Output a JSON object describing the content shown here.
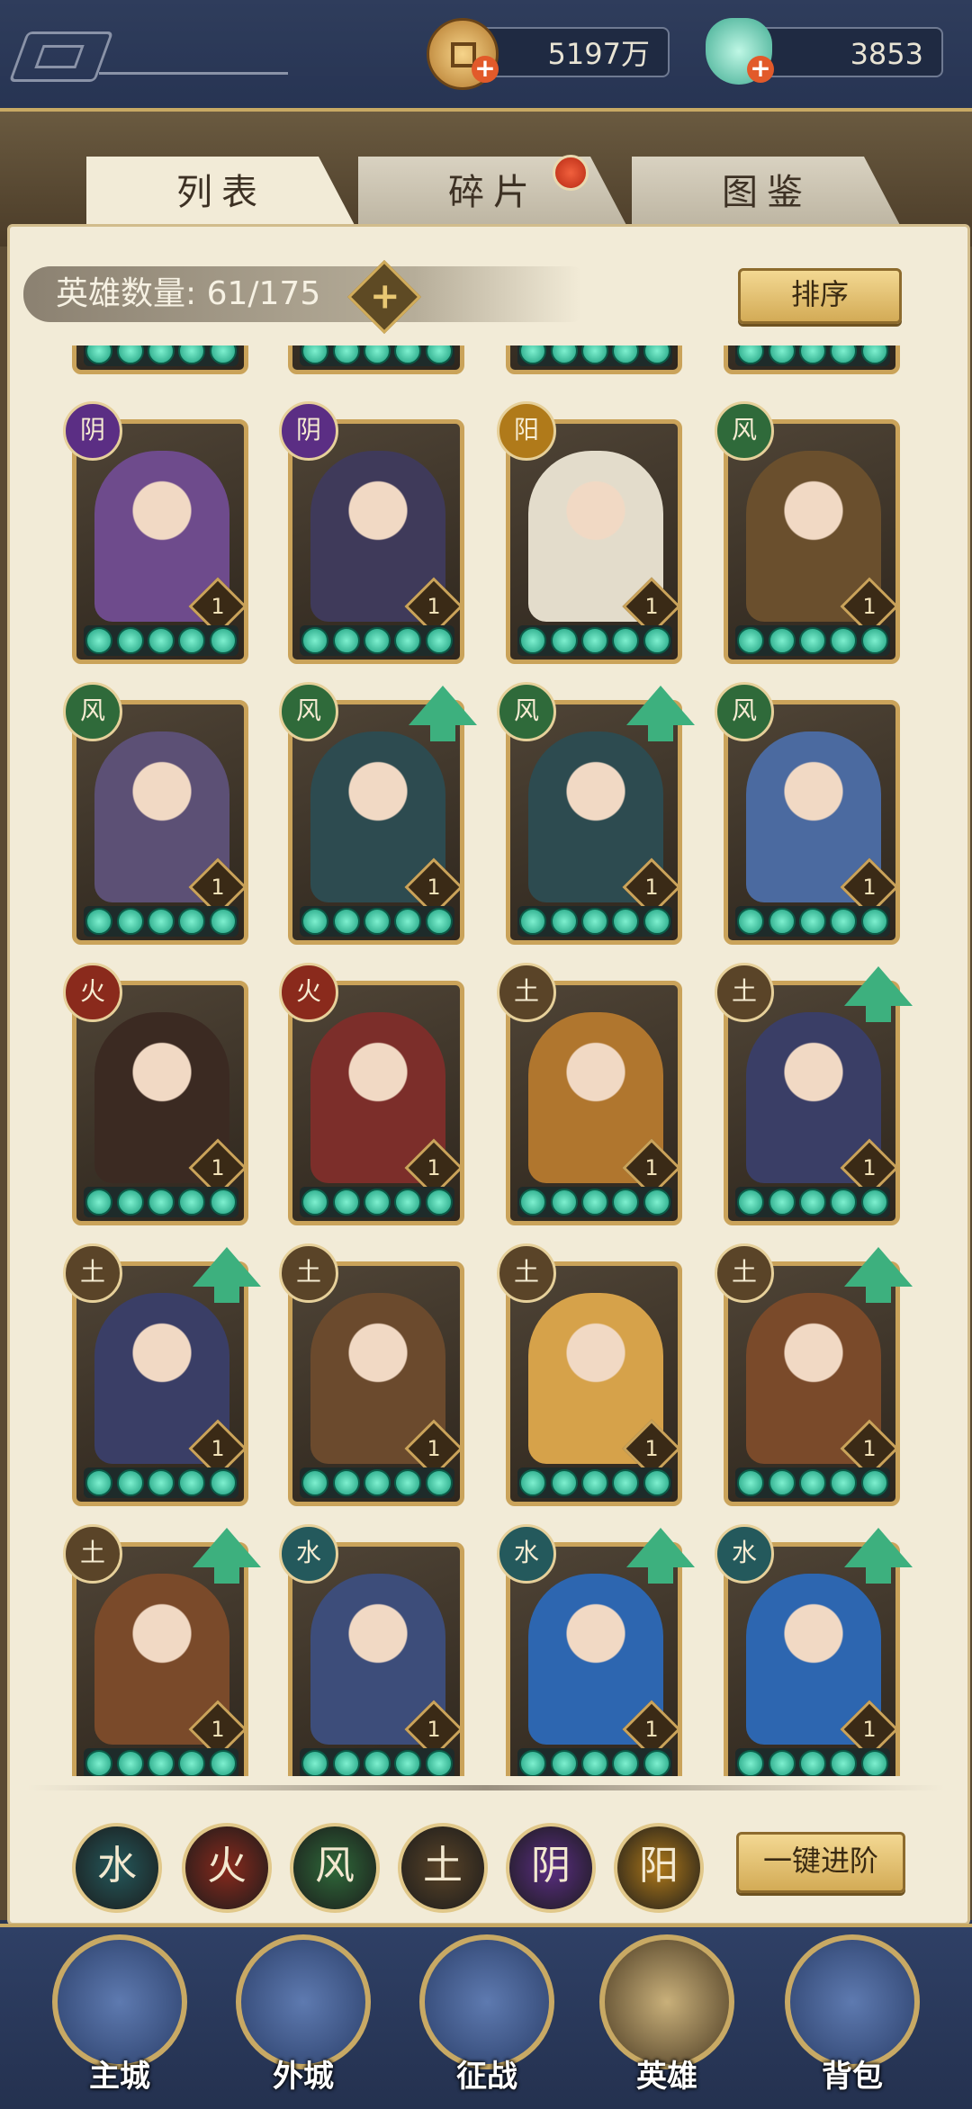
{
  "resources": {
    "coins": "5197万",
    "jade": "3853"
  },
  "tabs": [
    {
      "label": "列表"
    },
    {
      "label": "碎片"
    },
    {
      "label": "图鉴"
    }
  ],
  "hero_count": "英雄数量: 61/175",
  "sort_label": "排序",
  "advance_label": "一键进阶",
  "elements": [
    "水",
    "火",
    "风",
    "土",
    "阴",
    "阳"
  ],
  "heroes": [
    {
      "element": "阴",
      "level": "1",
      "upgrade": false
    },
    {
      "element": "阴",
      "level": "1",
      "upgrade": false
    },
    {
      "element": "阳",
      "level": "1",
      "upgrade": false
    },
    {
      "element": "风",
      "level": "1",
      "upgrade": false
    },
    {
      "element": "风",
      "level": "1",
      "upgrade": false
    },
    {
      "element": "风",
      "level": "1",
      "upgrade": true
    },
    {
      "element": "风",
      "level": "1",
      "upgrade": true
    },
    {
      "element": "风",
      "level": "1",
      "upgrade": false
    },
    {
      "element": "火",
      "level": "1",
      "upgrade": false
    },
    {
      "element": "火",
      "level": "1",
      "upgrade": false
    },
    {
      "element": "土",
      "level": "1",
      "upgrade": false
    },
    {
      "element": "土",
      "level": "1",
      "upgrade": true
    },
    {
      "element": "土",
      "level": "1",
      "upgrade": true
    },
    {
      "element": "土",
      "level": "1",
      "upgrade": false
    },
    {
      "element": "土",
      "level": "1",
      "upgrade": false
    },
    {
      "element": "土",
      "level": "1",
      "upgrade": true
    },
    {
      "element": "土",
      "level": "1",
      "upgrade": true
    },
    {
      "element": "水",
      "level": "1",
      "upgrade": false
    },
    {
      "element": "水",
      "level": "1",
      "upgrade": true
    },
    {
      "element": "水",
      "level": "1",
      "upgrade": true
    }
  ],
  "nav": [
    {
      "label": "主城"
    },
    {
      "label": "外城"
    },
    {
      "label": "征战"
    },
    {
      "label": "英雄"
    },
    {
      "label": "背包"
    }
  ],
  "colors": {
    "水": "#24595c",
    "火": "#8a2a1c",
    "风": "#2f6a3a",
    "土": "#5a4428",
    "阴": "#5b2e84",
    "阳": "#b07a1a"
  },
  "art_colors": [
    "#6e4b8c",
    "#3f3a5a",
    "#e3dccb",
    "#6a4f2d",
    "#5c5075",
    "#2d4b50",
    "#2d4b50",
    "#4b6aa0",
    "#3b2a22",
    "#7c2e2a",
    "#b0762e",
    "#3a3e66",
    "#3a3e66",
    "#6b4a2d",
    "#d6a24a",
    "#7a4a2a",
    "#7a4a2a",
    "#3d4d7a",
    "#2d66b0",
    "#2d66b0"
  ]
}
